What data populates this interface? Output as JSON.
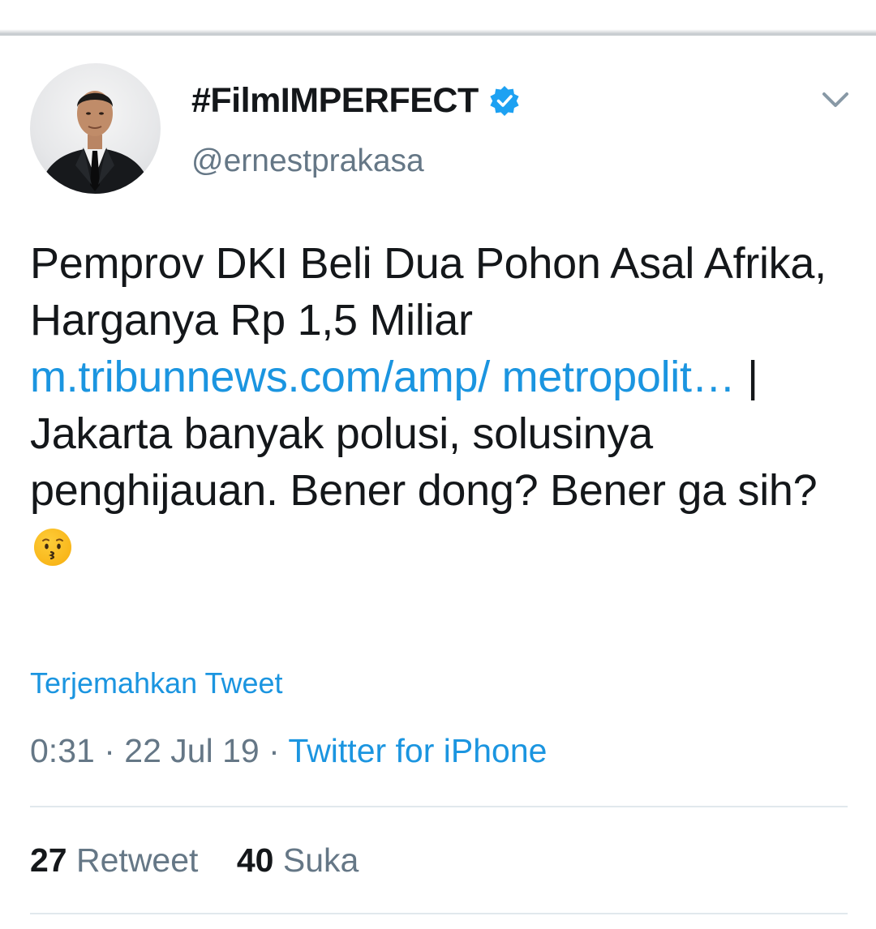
{
  "tweet": {
    "display_name": "#FilmIMPERFECT",
    "handle": "@ernestprakasa",
    "verified": true,
    "text_part1": "Pemprov DKI Beli Dua Pohon Asal Afrika, Harganya Rp 1,5 Miliar ",
    "link_text": "m.tribunnews.com/amp/ metropolit…",
    "text_part2": " | Jakarta banyak polusi, solusinya penghijauan. Bener dong? Bener ga sih? ",
    "emoji": "kissing-face-emoji",
    "translate_label": "Terjemahkan Tweet",
    "time": "0:31",
    "date": "22 Jul 19",
    "separator": "·",
    "source": "Twitter for iPhone"
  },
  "stats": {
    "retweets_count": "27",
    "retweets_label": "Retweet",
    "likes_count": "40",
    "likes_label": "Suka"
  },
  "colors": {
    "link": "#1b95e0",
    "secondary": "#657786",
    "primary_text": "#14171a",
    "verified_badge": "#1da1f2",
    "divider": "#e1e8ed"
  },
  "icons": {
    "verified": "verified-badge-icon",
    "menu": "chevron-down-icon"
  }
}
